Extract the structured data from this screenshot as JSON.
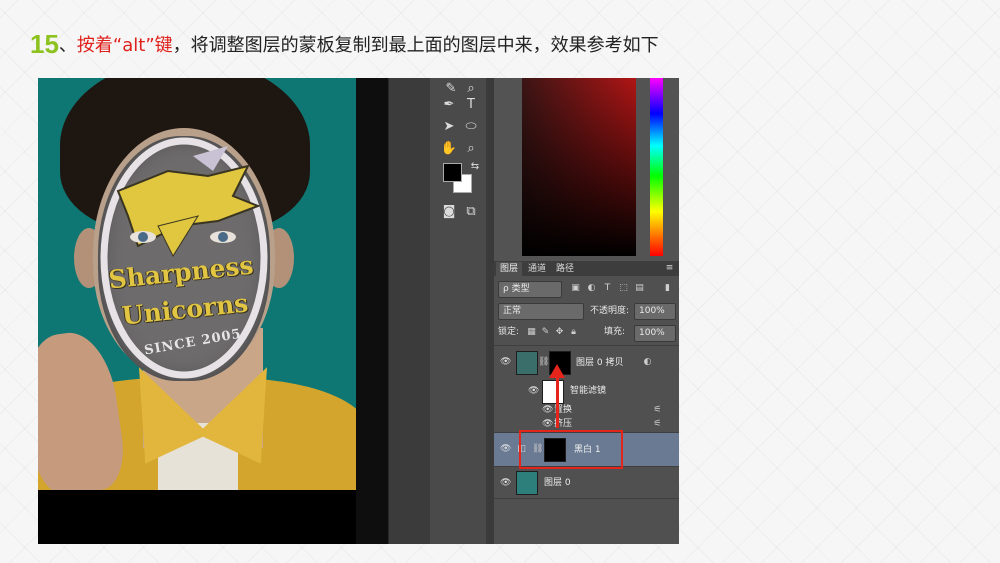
{
  "heading": {
    "number": "15",
    "sep": "、",
    "red_text": "按着“alt”键",
    "rest_text": "，将调整图层的蒙板复制到最上面的图层中来，效果参考如下"
  },
  "mask_text": {
    "line1": "Sharpness",
    "line2": "Unicorns",
    "line3": "SINCE 2005"
  },
  "layers_panel": {
    "tabs": [
      "图层",
      "通道",
      "路径"
    ],
    "kind_filter": "ρ 类型",
    "blend_mode": "正常",
    "opacity_label": "不透明度:",
    "opacity_value": "100%",
    "lock_label": "锁定:",
    "fill_label": "填充:",
    "fill_value": "100%",
    "layers": [
      {
        "name": "图层 0 拷贝"
      },
      {
        "name": "智能滤镜"
      },
      {
        "name": "置换"
      },
      {
        "name": "挤压"
      },
      {
        "name": "黑白 1"
      },
      {
        "name": "图层 0"
      }
    ]
  },
  "colors": {
    "accent_green": "#8dc21f",
    "accent_red": "#e0201b",
    "selection": "#6a7a93"
  }
}
